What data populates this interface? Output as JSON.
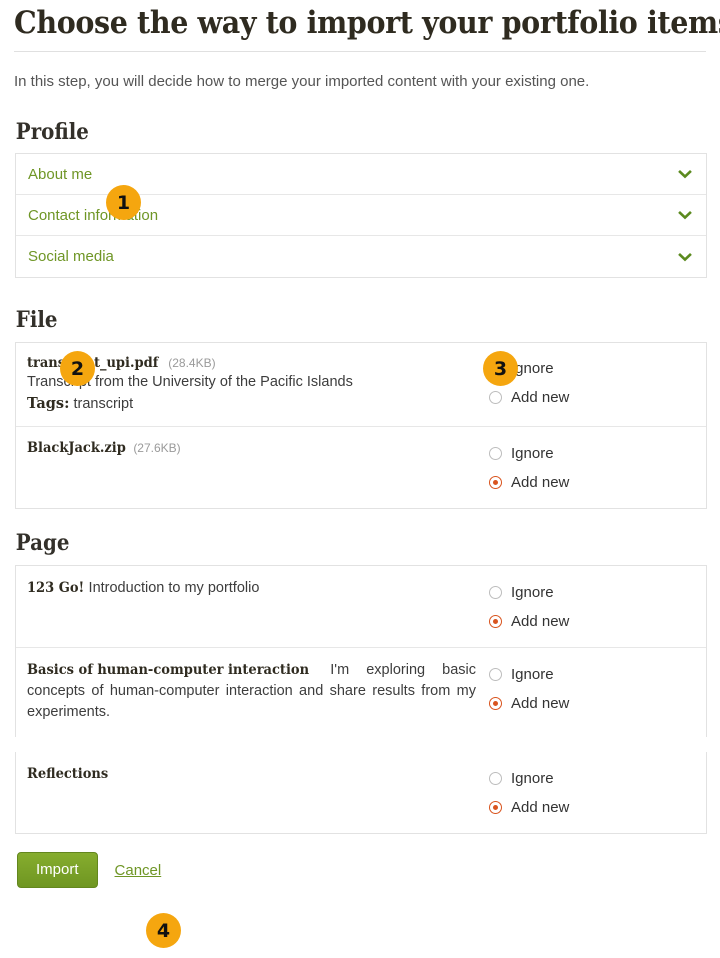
{
  "header": {
    "title": "Choose the way to import your portfolio items",
    "info_icon": "info-icon",
    "intro": "In this step, you will decide how to merge your imported content with your existing one."
  },
  "sections": {
    "profile": {
      "heading": "Profile",
      "items": [
        {
          "label": "About me",
          "icon": "chevron-down-icon"
        },
        {
          "label": "Contact information",
          "icon": "chevron-down-icon"
        },
        {
          "label": "Social media",
          "icon": "chevron-down-icon"
        }
      ]
    },
    "file": {
      "heading": "File",
      "rows": [
        {
          "title": "transcript_upi.pdf",
          "size": "(28.4KB)",
          "description": "Transcript from the University of the Pacific Islands",
          "tags_label": "Tags:",
          "tags_value": "transcript",
          "options": [
            {
              "label": "Ignore",
              "checked": true
            },
            {
              "label": "Add new",
              "checked": false
            }
          ]
        },
        {
          "title": "BlackJack.zip",
          "size": "(27.6KB)",
          "description": "",
          "options": [
            {
              "label": "Ignore",
              "checked": false
            },
            {
              "label": "Add new",
              "checked": true
            }
          ]
        }
      ]
    },
    "page": {
      "heading": "Page",
      "rows": [
        {
          "title": "123 Go!",
          "description": "Introduction to my portfolio",
          "options": [
            {
              "label": "Ignore",
              "checked": false
            },
            {
              "label": "Add new",
              "checked": true
            }
          ]
        },
        {
          "title": "Basics of human-computer interaction",
          "description": "I'm exploring basic concepts of human-computer interaction and share results from my experiments.",
          "options": [
            {
              "label": "Ignore",
              "checked": false
            },
            {
              "label": "Add new",
              "checked": true
            }
          ]
        },
        {
          "title": "Reflections",
          "description": "",
          "options": [
            {
              "label": "Ignore",
              "checked": false
            },
            {
              "label": "Add new",
              "checked": true
            }
          ]
        }
      ]
    }
  },
  "actions": {
    "import_label": "Import",
    "cancel_label": "Cancel"
  },
  "callouts": [
    {
      "number": "1"
    },
    {
      "number": "2"
    },
    {
      "number": "3"
    },
    {
      "number": "4"
    }
  ],
  "colors": {
    "accent_green": "#6f9626",
    "button_green": "#7ba428",
    "radio_checked": "#d9541e",
    "badge_orange": "#f5a60f",
    "heading": "#2f2b20",
    "info_blue": "#86b0e0"
  }
}
